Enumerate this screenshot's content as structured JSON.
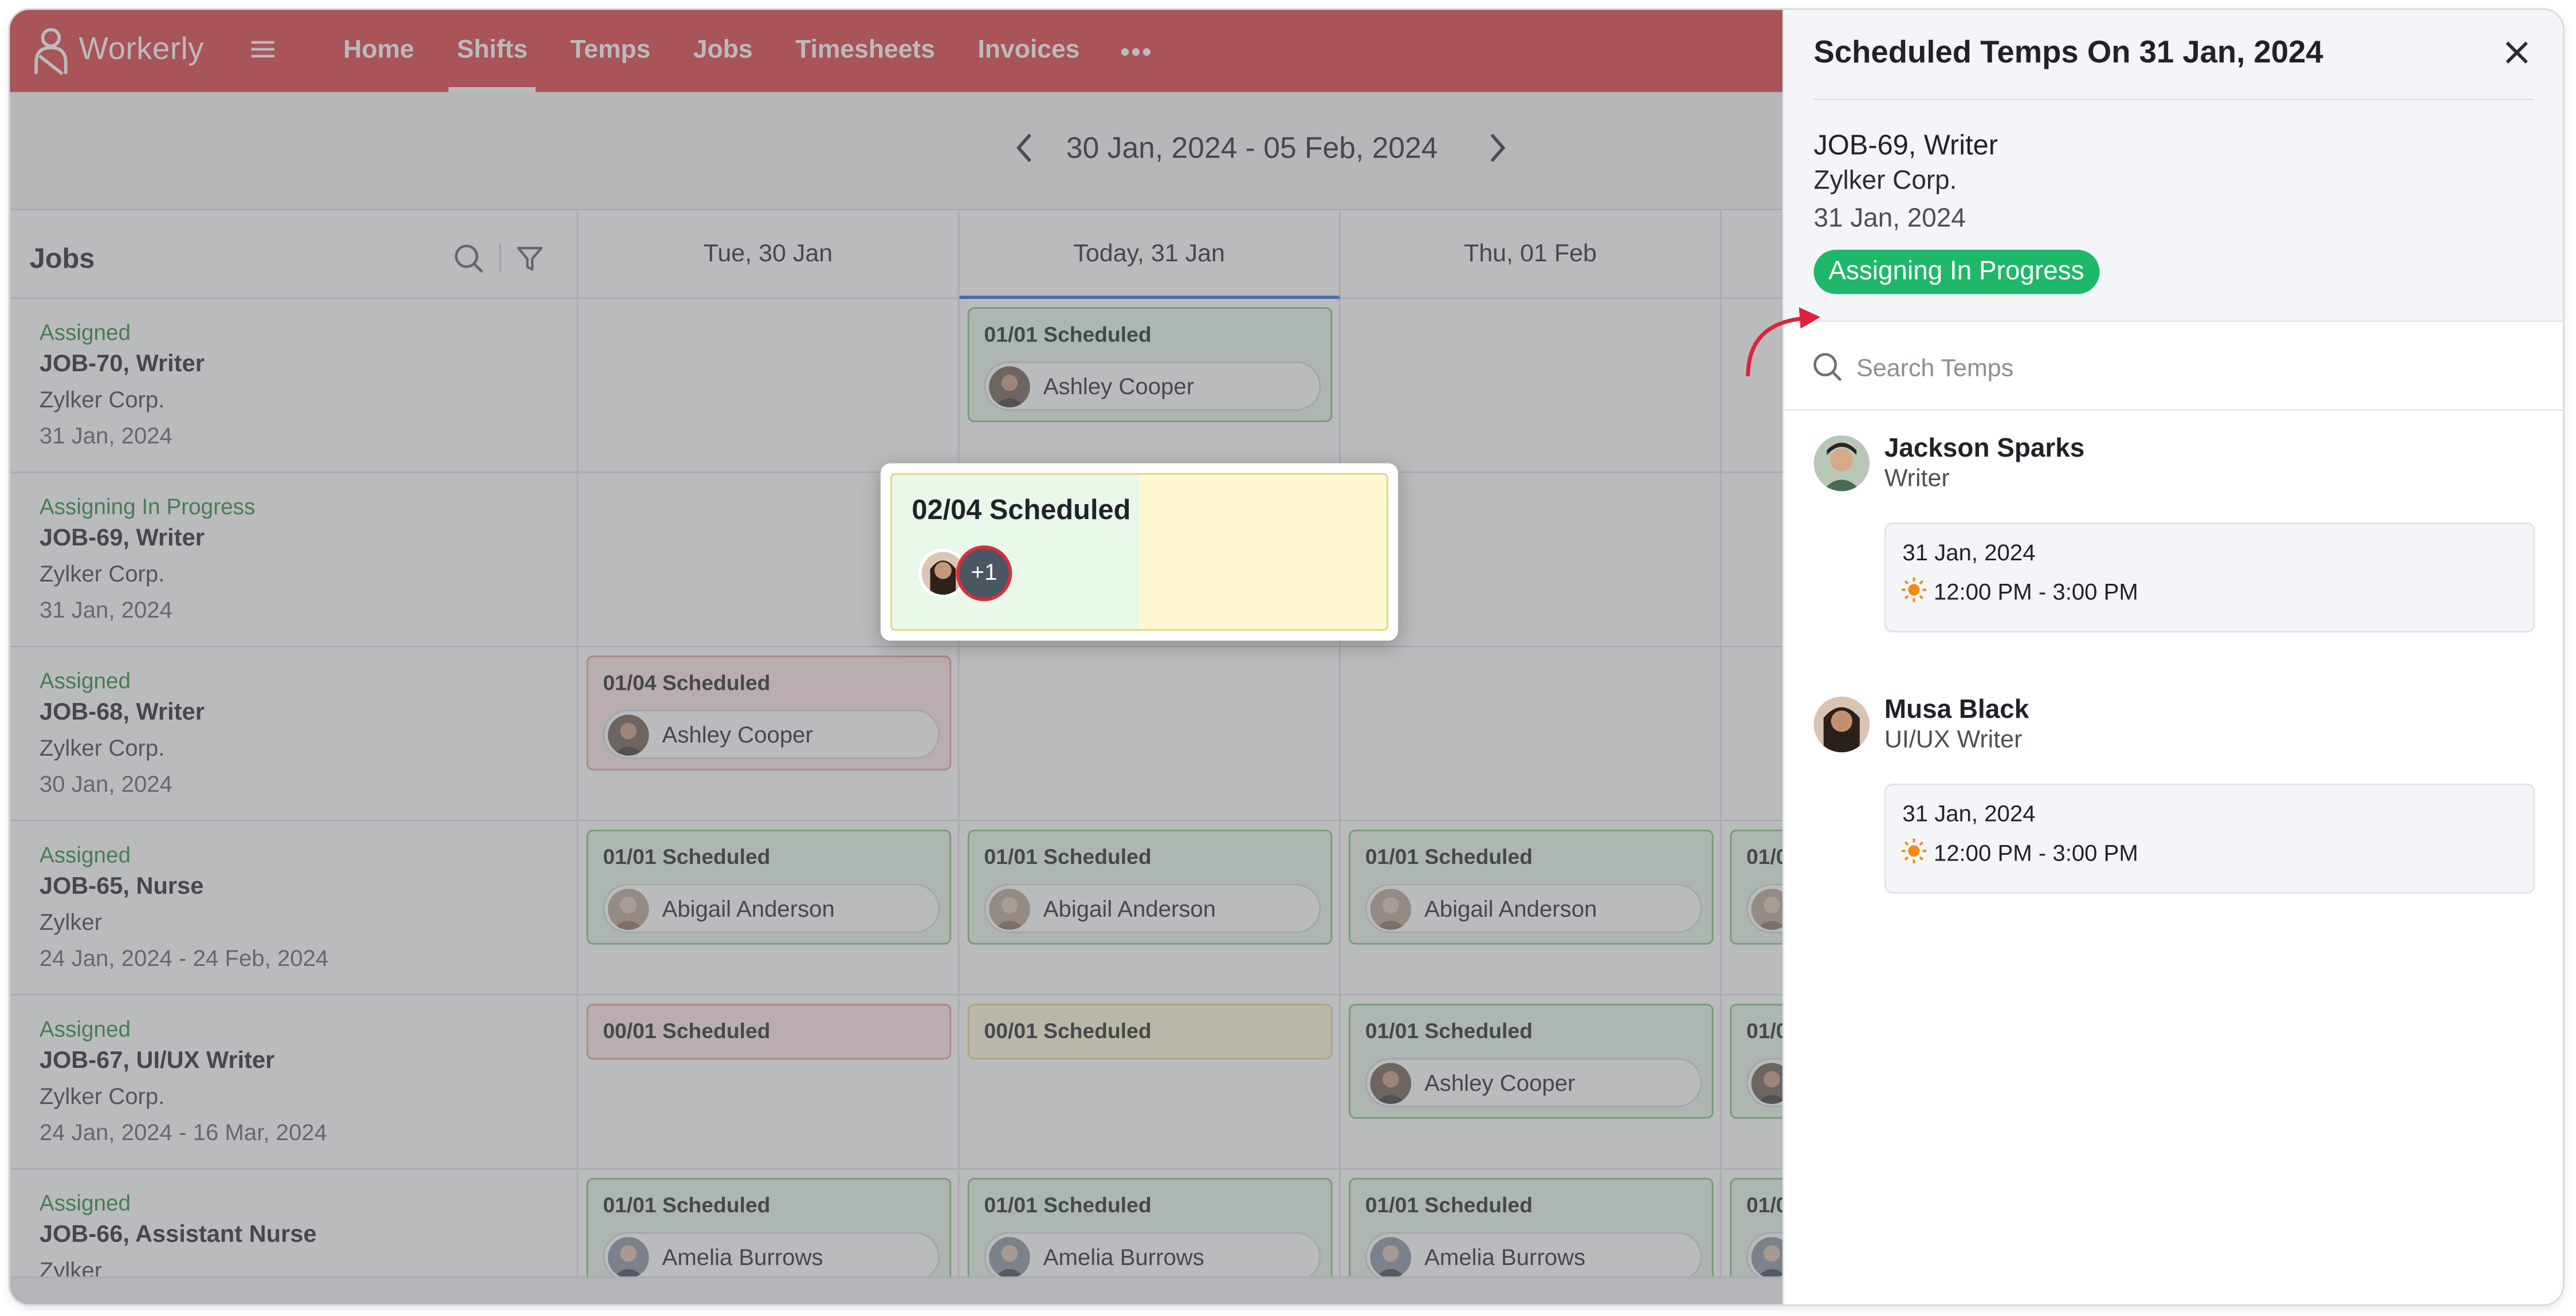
{
  "app": {
    "name": "Workerly",
    "nav": [
      "Home",
      "Shifts",
      "Temps",
      "Jobs",
      "Timesheets",
      "Invoices"
    ],
    "active_nav": "Shifts",
    "more_label": "•••"
  },
  "week": {
    "range": "30 Jan, 2024 - 05 Feb, 2024"
  },
  "jobs_header": "Jobs",
  "days": [
    "Tue, 30 Jan",
    "Today, 31 Jan",
    "Thu, 01 Feb"
  ],
  "jobs": [
    {
      "status": "Assigned",
      "name": "JOB-70, Writer",
      "client": "Zylker Corp.",
      "date": "31 Jan, 2024"
    },
    {
      "status": "Assigning In Progress",
      "name": "JOB-69, Writer",
      "client": "Zylker Corp.",
      "date": "31 Jan, 2024"
    },
    {
      "status": "Assigned",
      "name": "JOB-68, Writer",
      "client": "Zylker Corp.",
      "date": "30 Jan, 2024"
    },
    {
      "status": "Assigned",
      "name": "JOB-65, Nurse",
      "client": "Zylker",
      "date": "24 Jan, 2024 - 24 Feb, 2024"
    },
    {
      "status": "Assigned",
      "name": "JOB-67, UI/UX Writer",
      "client": "Zylker Corp.",
      "date": "24 Jan, 2024 - 16 Mar, 2024"
    },
    {
      "status": "Assigned",
      "name": "JOB-66, Assistant Nurse",
      "client": "Zylker",
      "date": ""
    }
  ],
  "shifts": {
    "r0_d1": {
      "title": "01/01 Scheduled",
      "temp": "Ashley Cooper"
    },
    "r2_d0": {
      "title": "01/04 Scheduled",
      "temp": "Ashley Cooper"
    },
    "r3_d0": {
      "title": "01/01 Scheduled",
      "temp": "Abigail Anderson"
    },
    "r3_d1": {
      "title": "01/01 Scheduled",
      "temp": "Abigail Anderson"
    },
    "r3_d2": {
      "title": "01/01 Scheduled",
      "temp": "Abigail Anderson"
    },
    "r3_d3": {
      "title": "01/0"
    },
    "r4_d0": {
      "title": "00/01 Scheduled"
    },
    "r4_d1": {
      "title": "00/01 Scheduled"
    },
    "r4_d2": {
      "title": "01/01 Scheduled",
      "temp": "Ashley Cooper"
    },
    "r4_d3": {
      "title": "01/0"
    },
    "r5_d0": {
      "title": "01/01 Scheduled",
      "temp": "Amelia Burrows"
    },
    "r5_d1": {
      "title": "01/01 Scheduled",
      "temp": "Amelia Burrows"
    },
    "r5_d2": {
      "title": "01/01 Scheduled",
      "temp": "Amelia Burrows"
    },
    "r5_d3": {
      "title": "01/0"
    }
  },
  "popup": {
    "title": "02/04 Scheduled",
    "more": "+1"
  },
  "panel": {
    "title": "Scheduled Temps On 31 Jan, 2024",
    "job": "JOB-69, Writer",
    "client": "Zylker Corp.",
    "date": "31 Jan, 2024",
    "status": "Assigning In Progress",
    "search_placeholder": "Search Temps",
    "temps": [
      {
        "name": "Jackson Sparks",
        "role": "Writer",
        "date": "31 Jan, 2024",
        "time": "12:00 PM - 3:00 PM"
      },
      {
        "name": "Musa Black",
        "role": "UI/UX Writer",
        "date": "31 Jan, 2024",
        "time": "12:00 PM - 3:00 PM"
      }
    ]
  },
  "colors": {
    "brand": "#dc3a3e",
    "assigned_text": "#1f8a3a",
    "status_badge": "#1fb86a",
    "today_underline": "#2e67d6"
  }
}
